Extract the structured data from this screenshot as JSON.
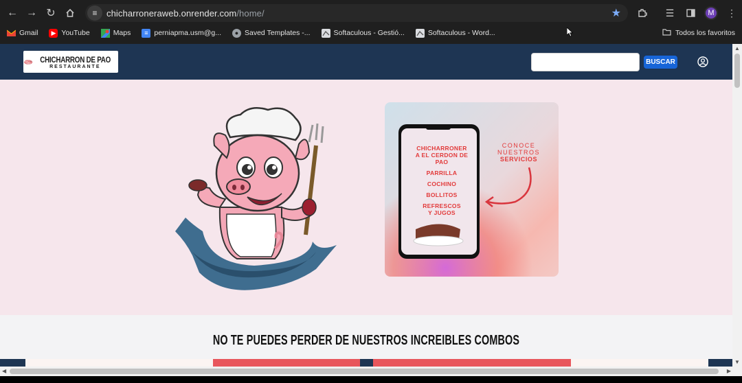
{
  "browser": {
    "url_host": "chicharroneraweb.onrender.com",
    "url_path": "/home/",
    "avatar_letter": "M",
    "bookmarks": [
      {
        "label": "Gmail",
        "icon": "gmail-icon"
      },
      {
        "label": "YouTube",
        "icon": "youtube-icon"
      },
      {
        "label": "Maps",
        "icon": "maps-icon"
      },
      {
        "label": "perniapma.usm@g...",
        "icon": "docs-icon"
      },
      {
        "label": "Saved Templates -...",
        "icon": "globe-icon"
      },
      {
        "label": "Softaculous - Gestió...",
        "icon": "softaculous-icon"
      },
      {
        "label": "Softaculous - Word...",
        "icon": "softaculous-icon"
      }
    ],
    "folder_label": "Todos los favoritos"
  },
  "site": {
    "logo_title": "CHICHARRON DE PAO",
    "logo_subtitle": "RESTAURANTE",
    "search_placeholder": "",
    "search_button": "BUSCAR",
    "promo": {
      "lines": [
        "CHICHARRONER",
        "A EL CERDON DE",
        "PAO",
        "PARRILLA",
        "COCHINO",
        "BOLLITOS",
        "REFRESCOS",
        "Y JUGOS"
      ],
      "side_text": [
        "CONOCE",
        "NUESTROS",
        "SERVICIOS"
      ]
    },
    "combos_heading": "NO TE PUEDES PERDER DE NUESTROS INCREIBLES COMBOS"
  },
  "colors": {
    "header_bg": "#1e3553",
    "hero_bg": "#f6e6ec",
    "button_blue": "#1765d8"
  }
}
